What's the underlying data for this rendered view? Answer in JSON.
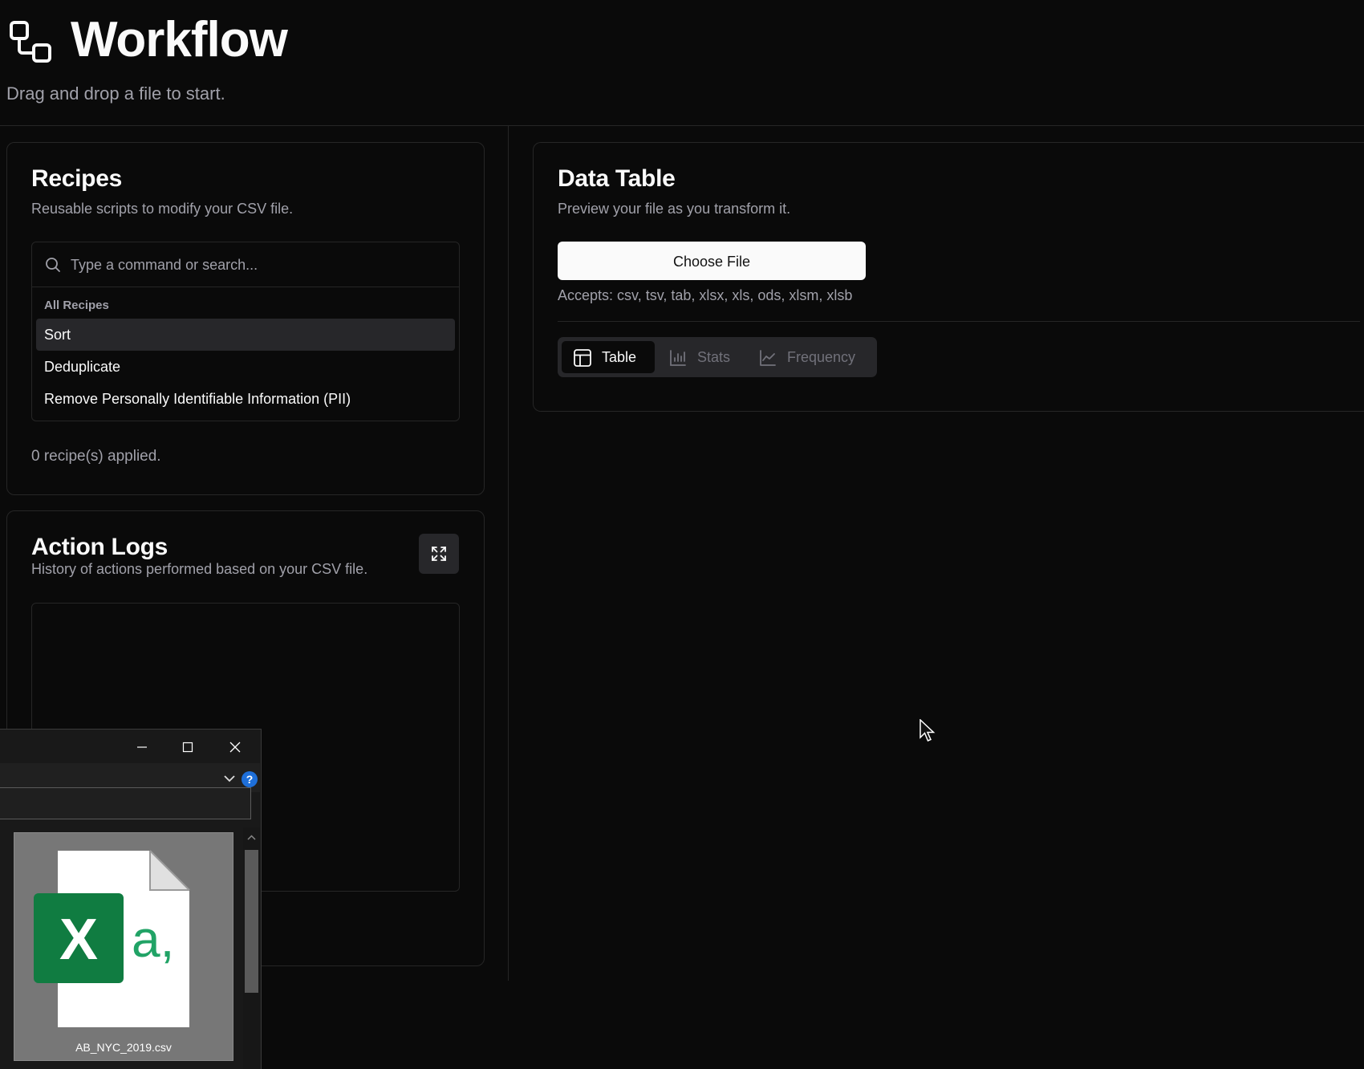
{
  "header": {
    "title": "Workflow",
    "subtitle": "Drag and drop a file to start."
  },
  "recipes": {
    "title": "Recipes",
    "description": "Reusable scripts to modify your CSV file.",
    "search_placeholder": "Type a command or search...",
    "group_label": "All Recipes",
    "items": [
      {
        "label": "Sort",
        "active": true
      },
      {
        "label": "Deduplicate",
        "active": false
      },
      {
        "label": "Remove Personally Identifiable Information (PII)",
        "active": false
      }
    ],
    "applied_status": "0 recipe(s) applied."
  },
  "action_logs": {
    "title": "Action Logs",
    "description": "History of actions performed based on your CSV file."
  },
  "data_table": {
    "title": "Data Table",
    "description": "Preview your file as you transform it.",
    "choose_file_label": "Choose File",
    "accepts": "Accepts: csv, tsv, tab, xlsx, xls, ods, xlsm, xlsb",
    "tabs": [
      {
        "label": "Table",
        "icon": "table-icon",
        "active": true
      },
      {
        "label": "Stats",
        "icon": "bar-chart-icon",
        "active": false
      },
      {
        "label": "Frequency",
        "icon": "line-chart-icon",
        "active": false
      }
    ]
  },
  "explorer": {
    "help_label": "?",
    "file": {
      "name": "AB_NYC_2019.csv",
      "icon": "excel-csv-file-icon",
      "badge_letter": "X",
      "badge_suffix": "a,"
    }
  },
  "colors": {
    "background": "#0a0a0a",
    "border": "#262626",
    "muted_text": "#a1a1aa",
    "excel_green": "#107c41",
    "csv_green": "#21a366"
  }
}
